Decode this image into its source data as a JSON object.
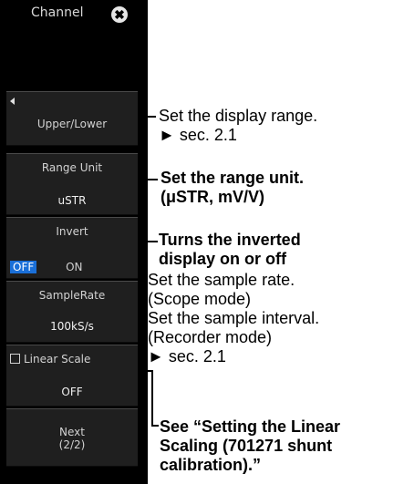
{
  "panel": {
    "title": "Channel",
    "close_icon": "✖",
    "upper_lower": {
      "label": "Upper/Lower"
    },
    "range_unit": {
      "label": "Range Unit",
      "value": "uSTR"
    },
    "invert": {
      "label": "Invert",
      "off": "OFF",
      "on": "ON"
    },
    "sample_rate": {
      "label": "SampleRate",
      "value": "100kS/s"
    },
    "linear_scale": {
      "label": "Linear Scale",
      "value": "OFF"
    },
    "next": {
      "label": "Next",
      "page": "(2/2)"
    }
  },
  "annotations": {
    "upper_lower": {
      "line1": "Set the display range.",
      "line2": "► sec. 2.1"
    },
    "range_unit": {
      "line1": "Set the range unit.",
      "line2": "(μSTR, mV/V)"
    },
    "invert": {
      "line1": "Turns the inverted",
      "line2": "display on or off"
    },
    "sample_rate": {
      "line1": "Set the sample rate.",
      "line2": "(Scope mode)",
      "line3": "Set the sample interval.",
      "line4": "(Recorder mode)",
      "line5": "► sec. 2.1"
    },
    "linear_scale": {
      "line1": "See “Setting the Linear",
      "line2": "Scaling (701271 shunt",
      "line3": "calibration).”"
    }
  },
  "colors": {
    "panel_bg": "#000000",
    "button_bg": "#1f1f1f",
    "off_highlight": "#1a6fd8"
  }
}
